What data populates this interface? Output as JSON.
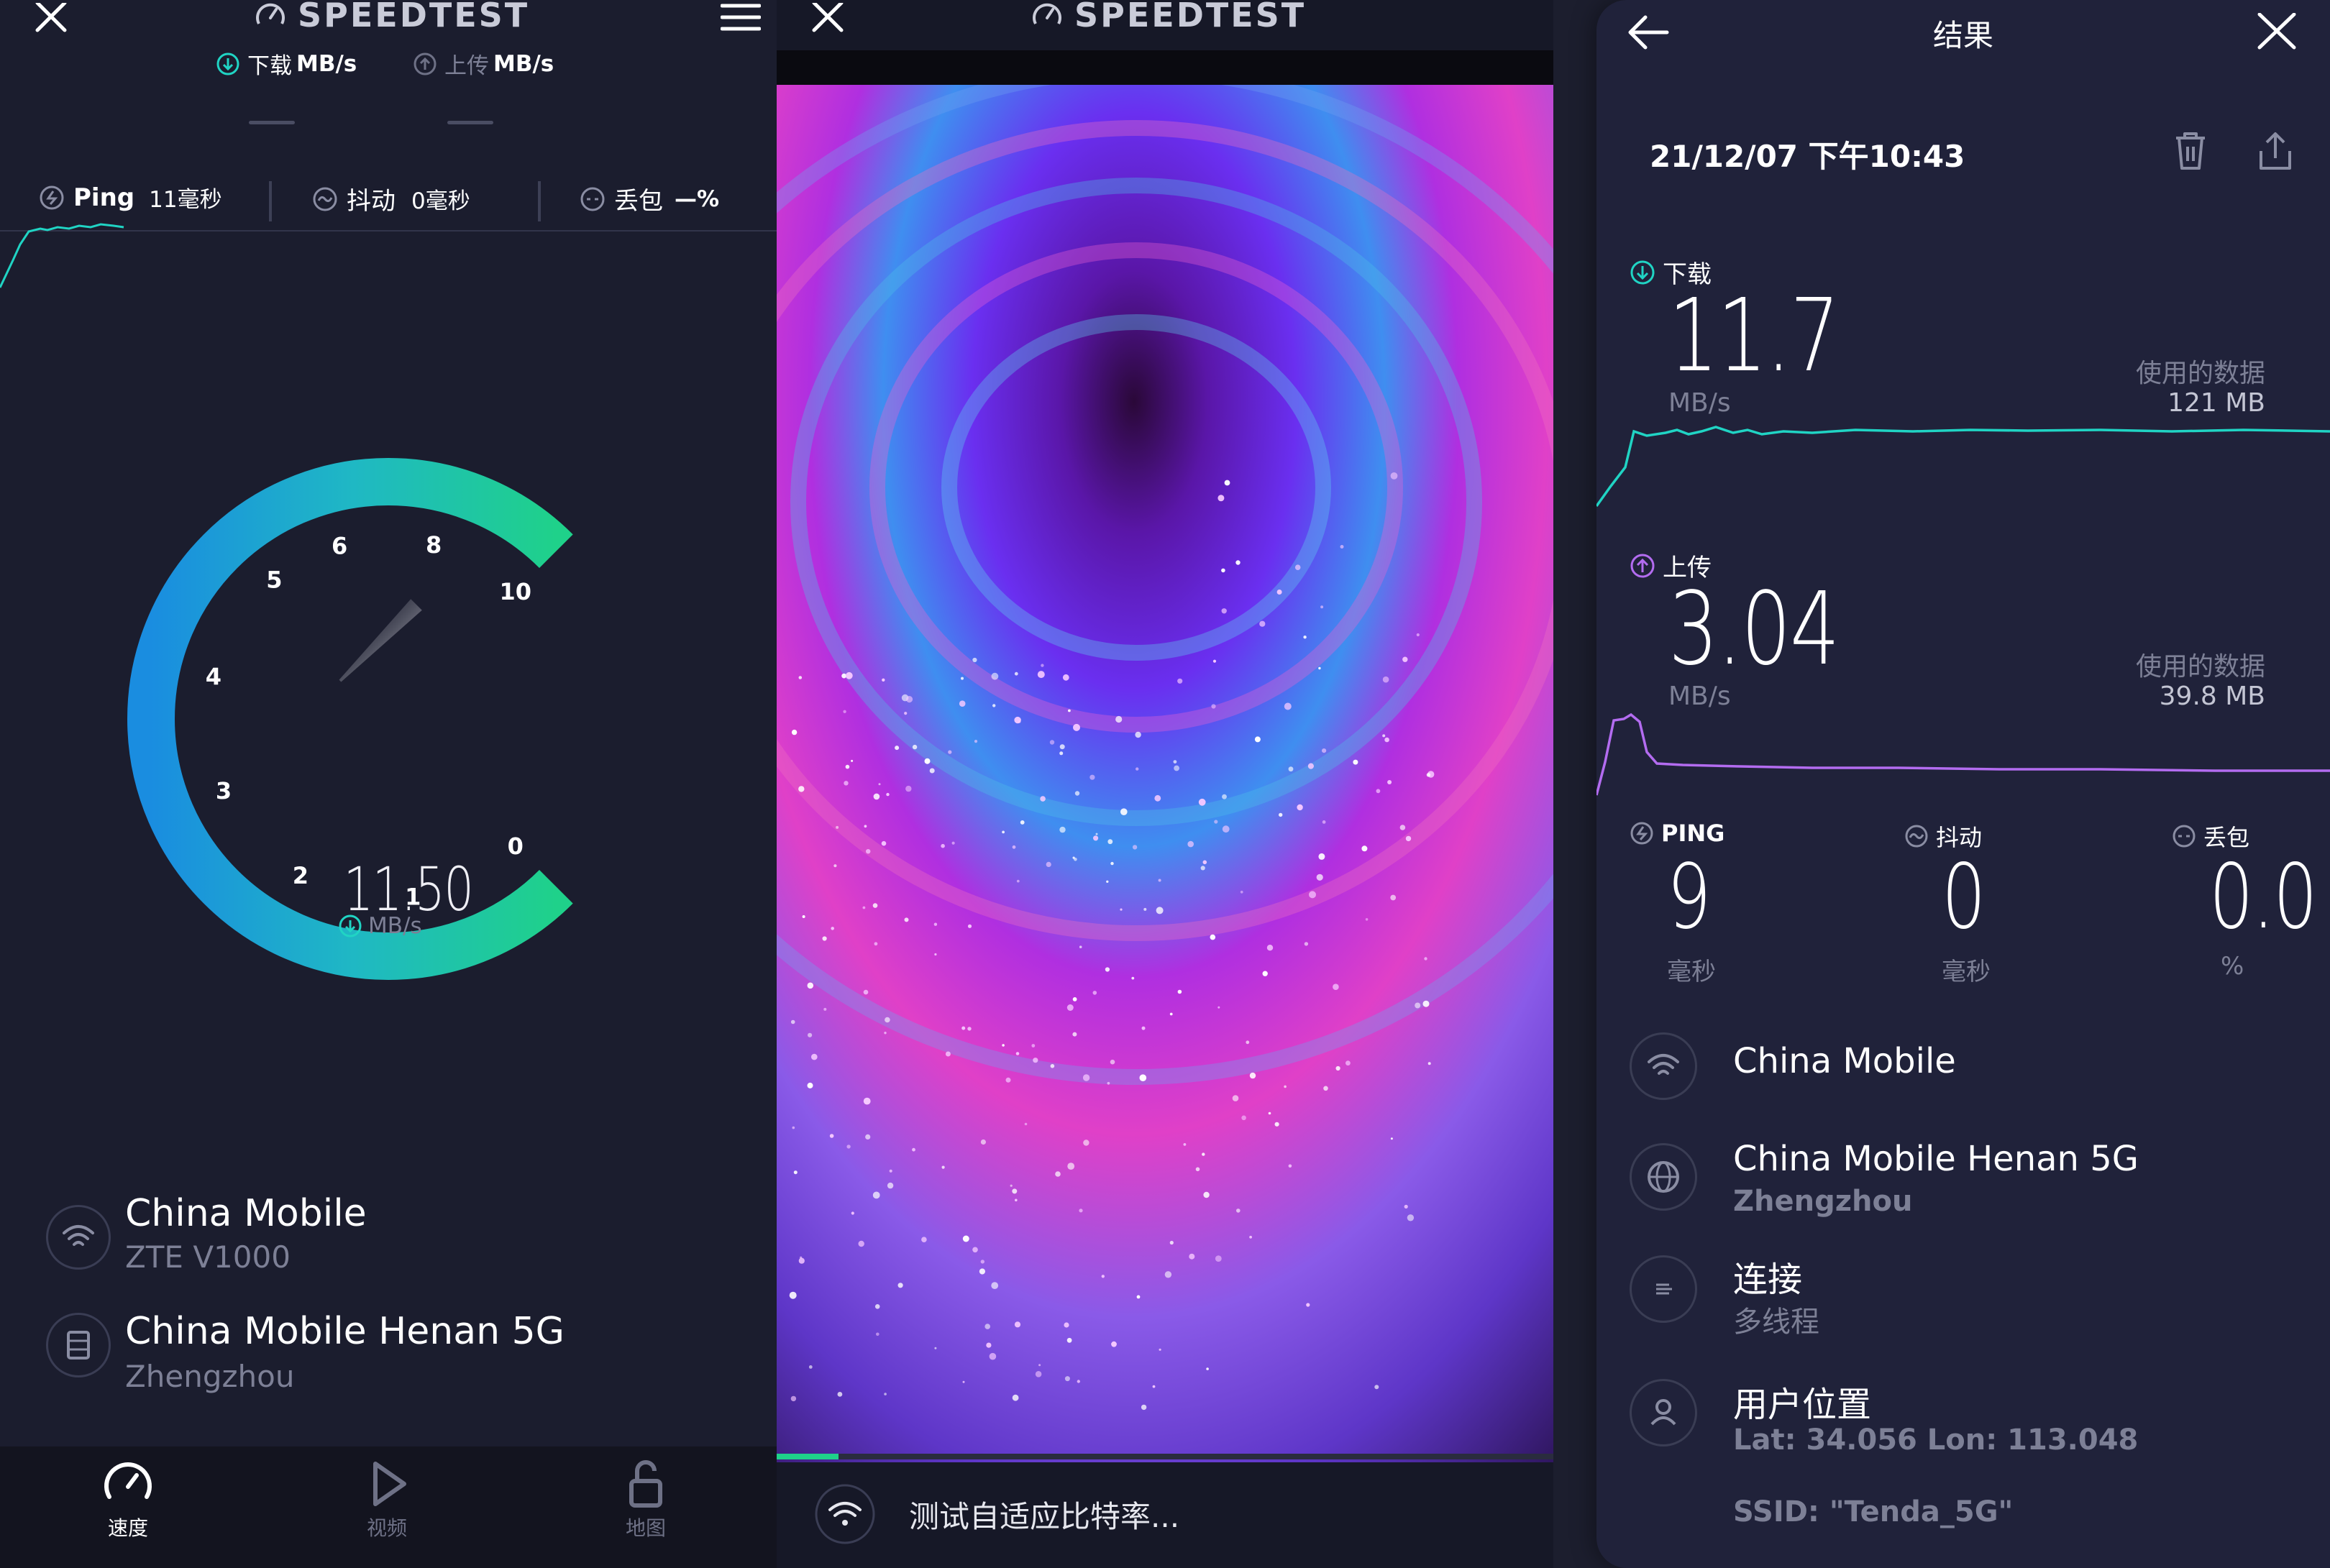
{
  "colors": {
    "background": "#1b1d2e",
    "accent_teal": "#20d4c4",
    "accent_purple": "#b36cf0",
    "gauge_start": "#1d9fe6",
    "gauge_end": "#1fd19a",
    "text_dim": "#7d8096"
  },
  "left": {
    "close_icon": "close-icon",
    "menu_icon": "hamburger-icon",
    "app_title": "SPEEDTEST",
    "download_label": "下载",
    "download_unit": "MB/s",
    "upload_label": "上传",
    "upload_unit": "MB/s",
    "ping_label": "Ping",
    "ping_value": "11毫秒",
    "jitter_label": "抖动",
    "jitter_value": "0毫秒",
    "loss_label": "丢包",
    "loss_value": "—%",
    "gauge": {
      "ticks": [
        "0",
        "1",
        "2",
        "3",
        "4",
        "5",
        "6",
        "8",
        "10"
      ],
      "value": "11.50",
      "unit": "MB/s",
      "max": 10
    },
    "provider": {
      "name": "China Mobile",
      "device": "ZTE V1000"
    },
    "server": {
      "name": "China Mobile Henan 5G",
      "city": "Zhengzhou"
    },
    "nav": [
      {
        "label": "速度",
        "icon": "speedometer-icon",
        "active": true
      },
      {
        "label": "视频",
        "icon": "play-icon",
        "active": false
      },
      {
        "label": "地图",
        "icon": "lock-icon",
        "active": false
      }
    ]
  },
  "middle": {
    "app_title": "SPEEDTEST",
    "progress": 0.08,
    "status_text": "测试自适应比特率..."
  },
  "right": {
    "header_title": "结果",
    "datetime": "21/12/07 下午10:43",
    "download": {
      "label": "下载",
      "value": "11.7",
      "unit": "MB/s",
      "data_label": "使用的数据",
      "data_value": "121 MB"
    },
    "upload": {
      "label": "上传",
      "value": "3.04",
      "unit": "MB/s",
      "data_label": "使用的数据",
      "data_value": "39.8 MB"
    },
    "ping": {
      "label": "PING",
      "value": "9",
      "unit": "毫秒"
    },
    "jitter": {
      "label": "抖动",
      "value": "0",
      "unit": "毫秒"
    },
    "loss": {
      "label": "丢包",
      "value": "0.0",
      "unit": "%"
    },
    "provider": {
      "name": "China Mobile"
    },
    "server": {
      "name": "China Mobile Henan 5G",
      "city": "Zhengzhou"
    },
    "connection": {
      "label": "连接",
      "value": "多线程"
    },
    "location": {
      "label": "用户位置",
      "value": "Lat: 34.056 Lon: 113.048"
    },
    "ssid": "SSID: \"Tenda_5G\""
  }
}
